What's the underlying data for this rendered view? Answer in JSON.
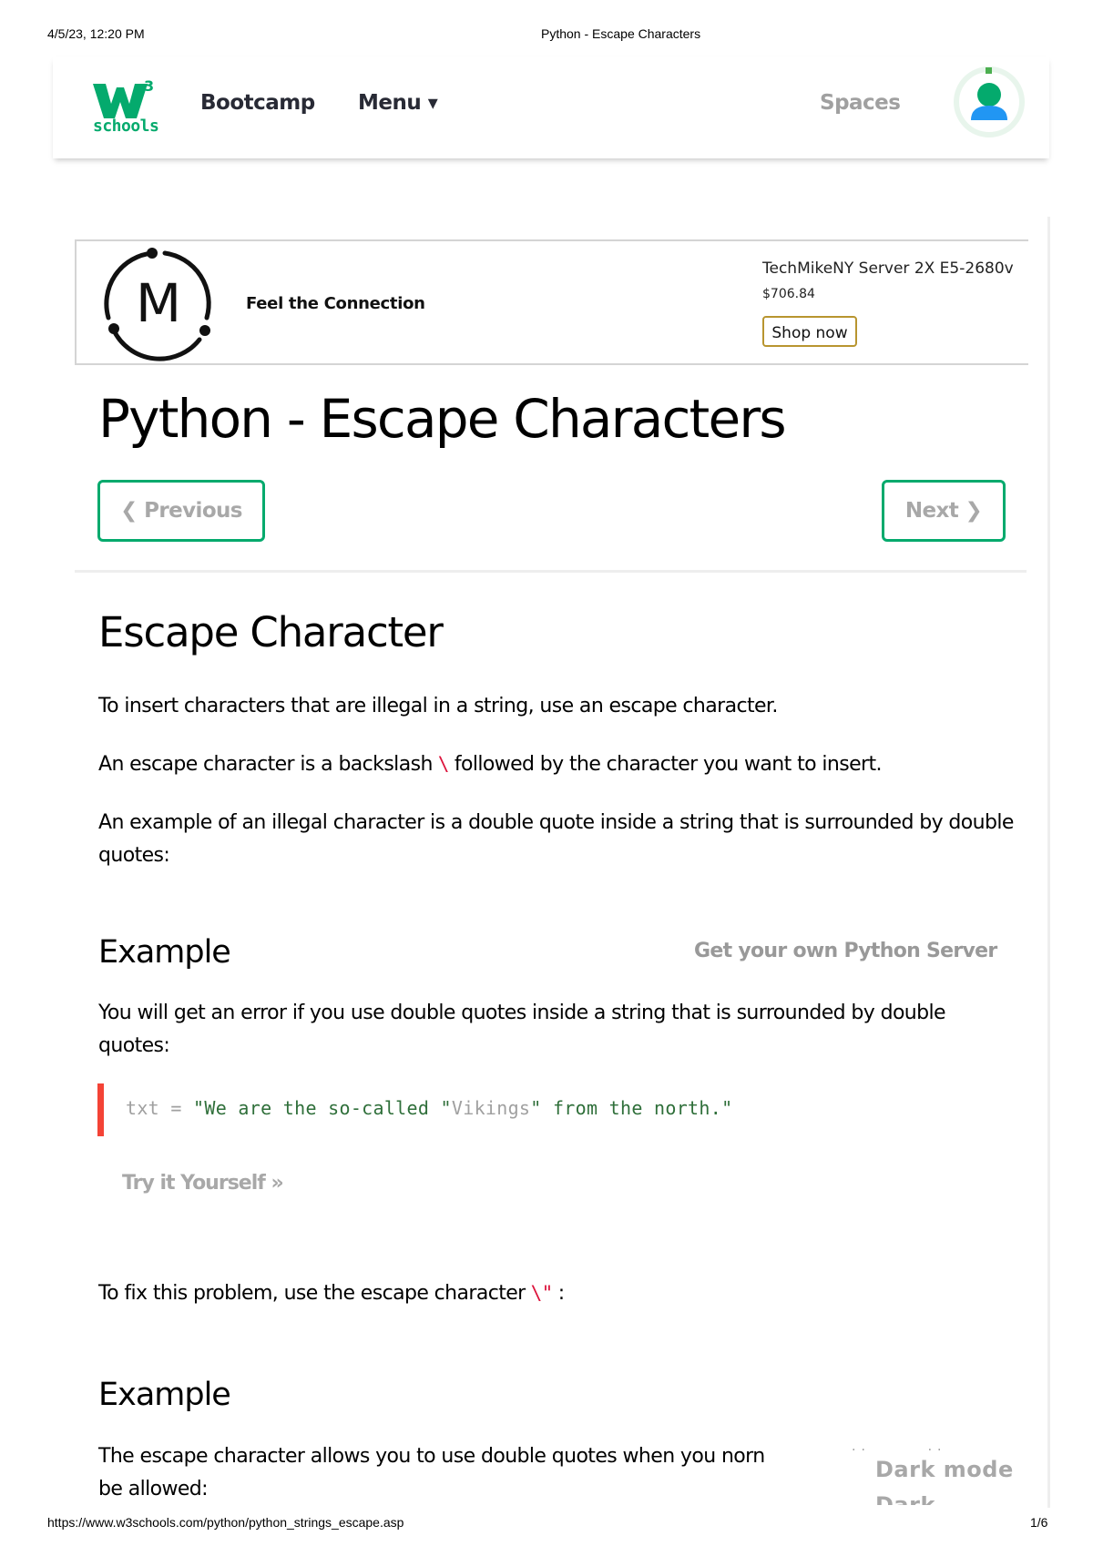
{
  "print_header": {
    "datetime": "4/5/23, 12:20 PM",
    "title": "Python - Escape Characters"
  },
  "topnav": {
    "logo_text": "schools",
    "logo_sup": "3",
    "bootcamp": "Bootcamp",
    "menu": "Menu",
    "menu_caret": "▾",
    "spaces": "Spaces"
  },
  "ad": {
    "logo_letter": "M",
    "tagline": "Feel the Connection",
    "product": "TechMikeNY Server 2X E5-2680v",
    "price": "$706.84",
    "cta": "Shop now"
  },
  "main": {
    "title": "Python - Escape Characters",
    "prev_label": "❮ Previous",
    "next_label": "Next ❯",
    "section_title": "Escape Character",
    "p1": "To insert characters that are illegal in a string, use an escape character.",
    "p2_before": "An escape character is a backslash",
    "p2_code": "\\",
    "p2_after": "followed by the character you want to insert.",
    "p3": "An example of an illegal character is a double quote inside a string that is surrounded by double quotes:",
    "example1": {
      "heading": "Example",
      "server_link": "Get your own Python Server",
      "description": "You will get an error if you use double quotes inside a string that is surrounded by double quotes:",
      "code": {
        "var": "txt = ",
        "str1": "\"We are the so-called \"",
        "mid": "Vikings",
        "str2": "\" from the north.\""
      },
      "try_it": "Try it Yourself »"
    },
    "fix_before": "To fix this problem, use the escape character",
    "fix_code": "\\\"",
    "fix_after": ":",
    "example2": {
      "heading": "Example",
      "description": "The escape character allows you to use double quotes when you norn",
      "description_line2": "be allowed:"
    },
    "dark_mode": "Dark mode",
    "dark_mode_2": "Dark mode"
  },
  "print_footer": {
    "url": "https://www.w3schools.com/python/python_strings_escape.asp",
    "page": "1/6"
  },
  "colors": {
    "brand_green": "#04aa6d",
    "code_red": "#dc143c",
    "note_red": "#f44336",
    "shop_border": "#b8952f",
    "avatar_blue": "#2196f3"
  }
}
